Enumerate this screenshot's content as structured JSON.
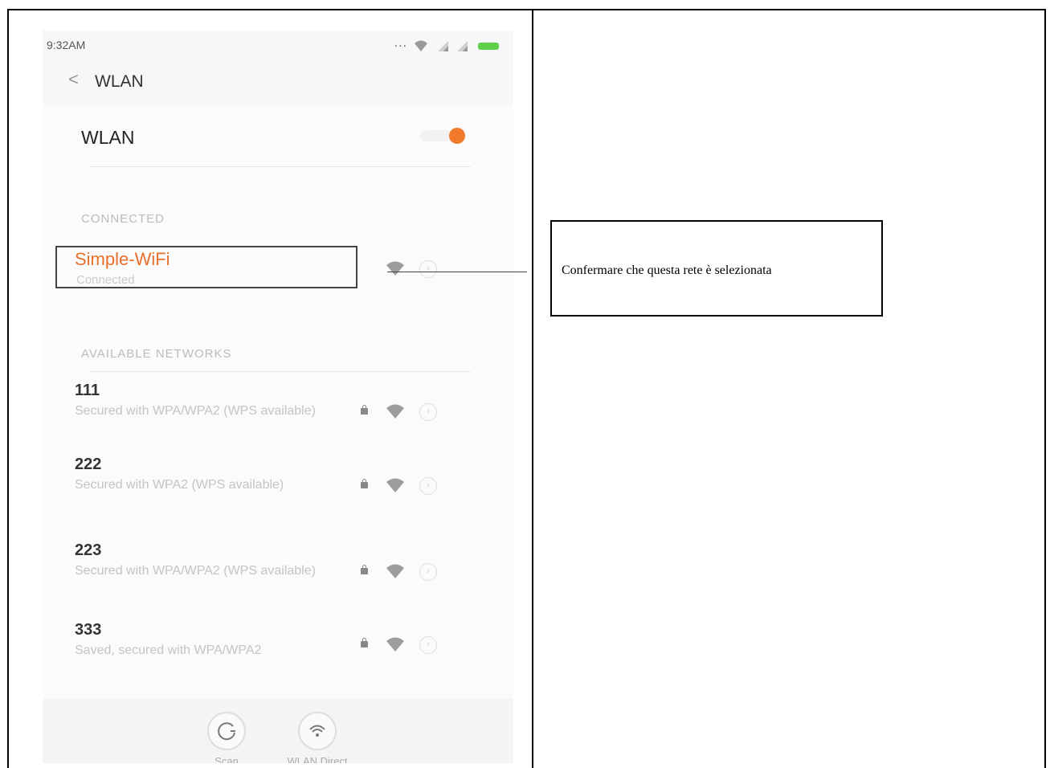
{
  "phone": {
    "status_bar": {
      "time": "9:32AM",
      "dots": "...",
      "icons": [
        "wifi-icon",
        "signal-icon",
        "signal-icon",
        "battery-icon"
      ],
      "battery_color": "#5fcf4a"
    },
    "header": {
      "back_glyph": "<",
      "title": "WLAN"
    },
    "wlan_toggle": {
      "label": "WLAN",
      "state": "on",
      "accent_color": "#f27a2b"
    },
    "connected_section": {
      "heading": "CONNECTED",
      "network": {
        "name": "Simple-WiFi",
        "status": "Connected"
      }
    },
    "available_section": {
      "heading": "AVAILABLE NETWORKS",
      "networks": [
        {
          "name": "111",
          "desc": "Secured with WPA/WPA2 (WPS available)"
        },
        {
          "name": "222",
          "desc": "Secured with WPA2 (WPS available)"
        },
        {
          "name": "223",
          "desc": "Secured with WPA/WPA2 (WPS available)"
        },
        {
          "name": "333",
          "desc": "Saved, secured with WPA/WPA2"
        }
      ]
    },
    "bottom_bar": {
      "scan_label": "Scan",
      "wlan_direct_label": "WLAN Direct"
    }
  },
  "annotation": {
    "text": "Confermare che questa rete è selezionata"
  }
}
